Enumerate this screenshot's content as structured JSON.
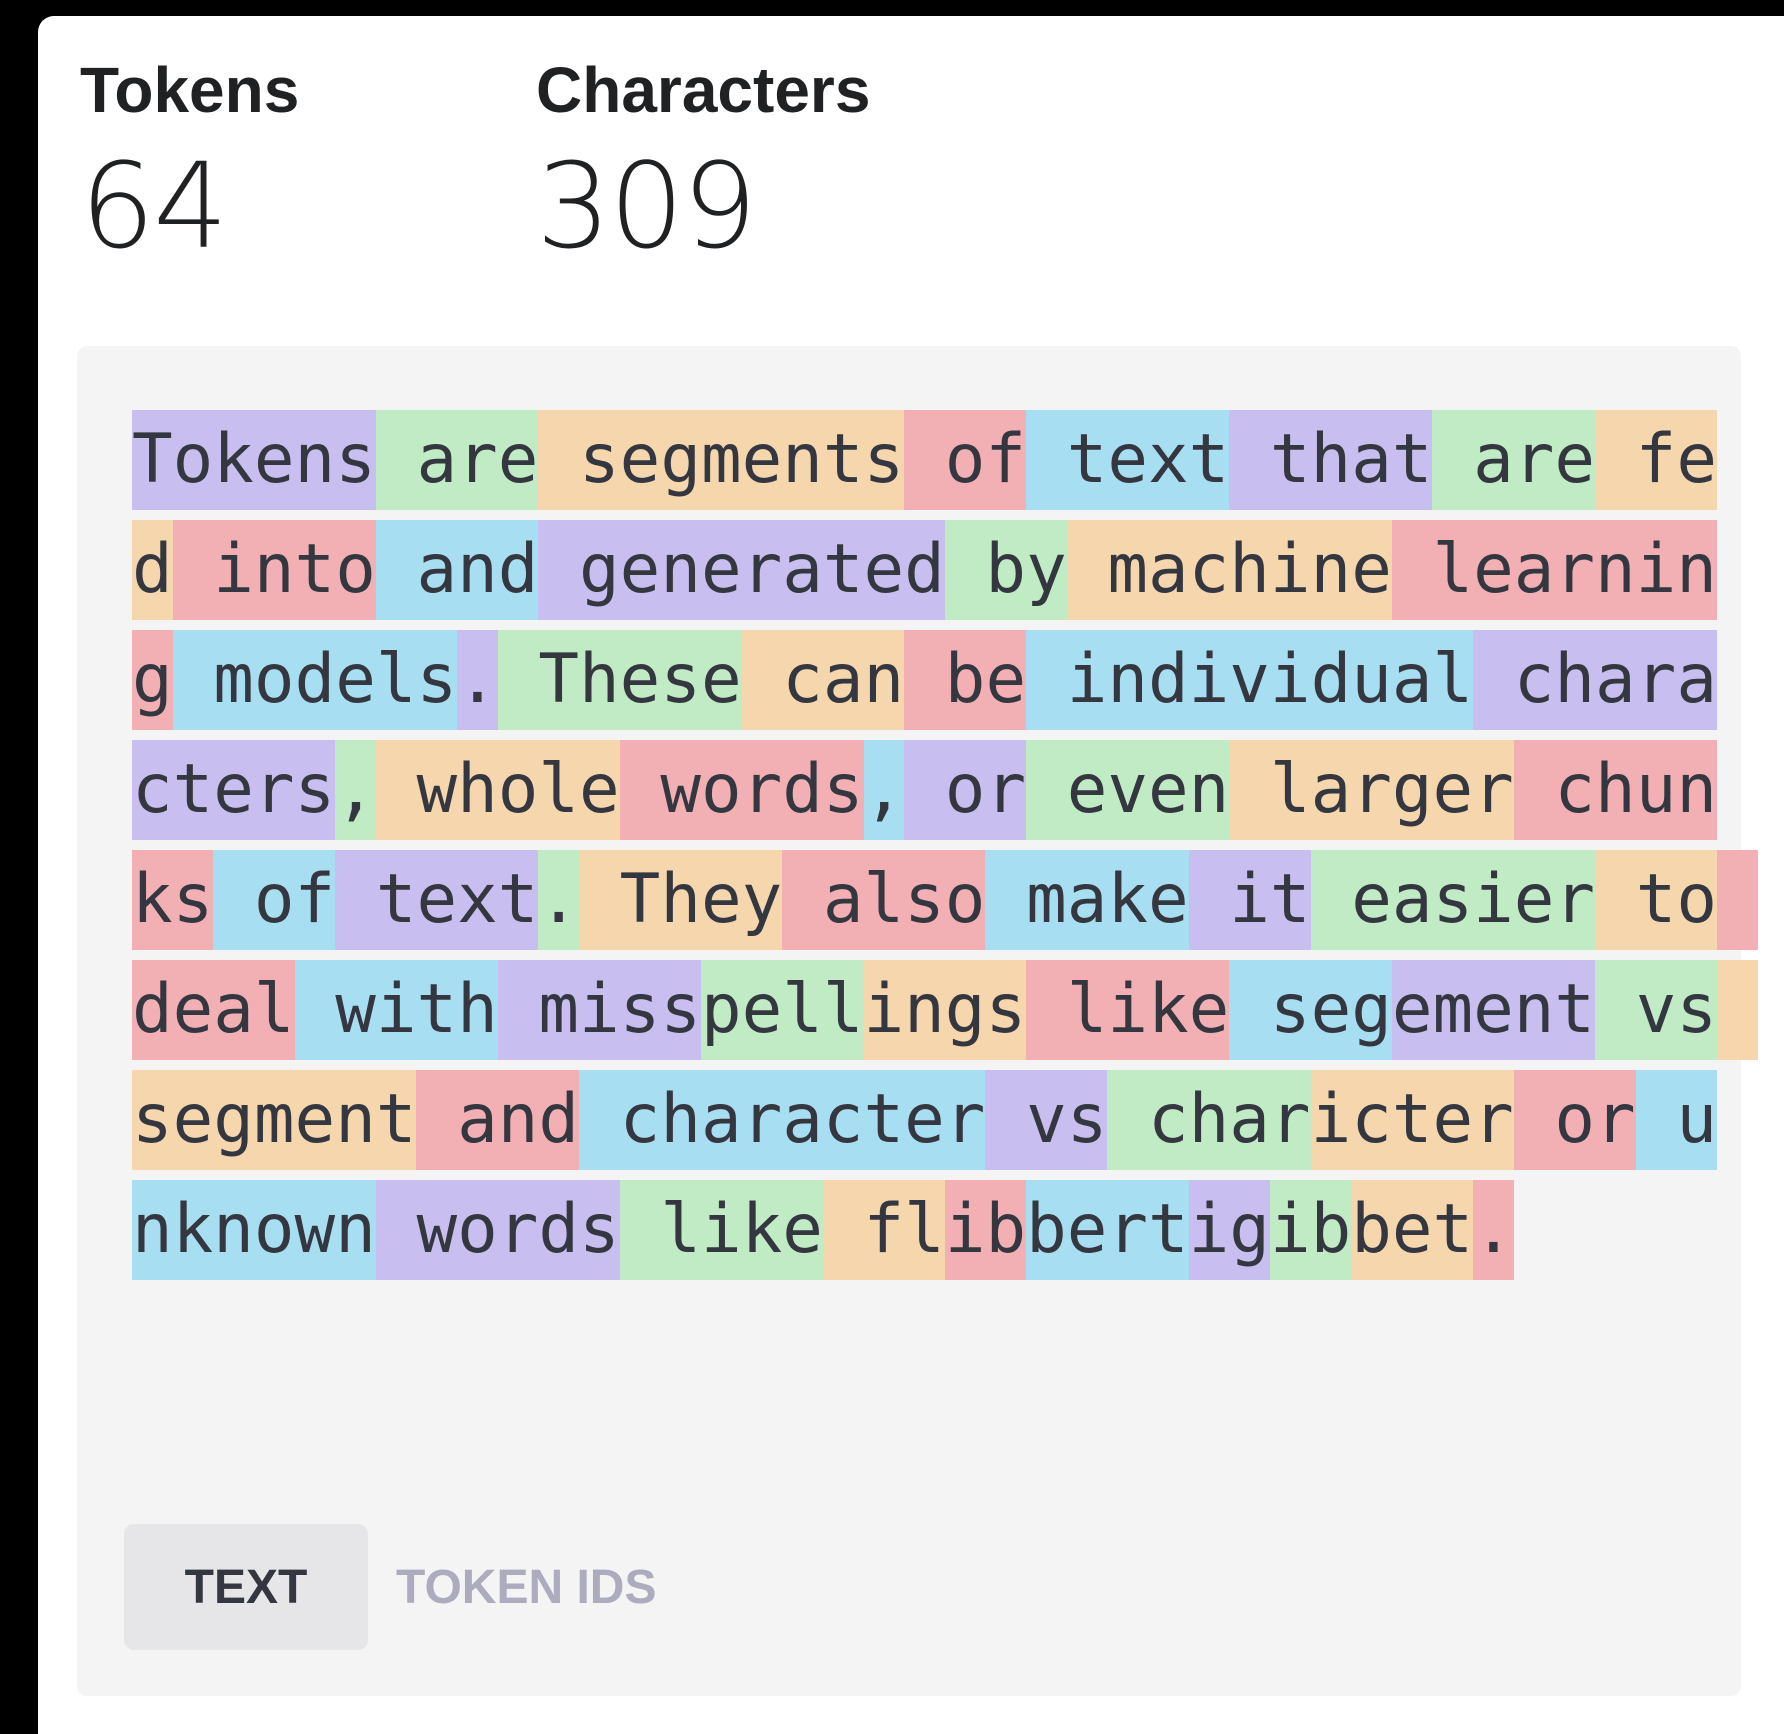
{
  "stats": {
    "tokens_label": "Tokens",
    "tokens_value": "64",
    "characters_label": "Characters",
    "characters_value": "309"
  },
  "token_colors": [
    "#c8bef0",
    "#c0ebc4",
    "#f5d6ad",
    "#f2b0b5",
    "#a8def2"
  ],
  "tokens": [
    {
      "t": "Tokens",
      "c": 0
    },
    {
      "t": " are",
      "c": 1
    },
    {
      "t": " segments",
      "c": 2
    },
    {
      "t": " of",
      "c": 3
    },
    {
      "t": " text",
      "c": 4
    },
    {
      "t": " that",
      "c": 0
    },
    {
      "t": " are",
      "c": 1
    },
    {
      "t": " fed",
      "c": 2
    },
    {
      "t": " into",
      "c": 3
    },
    {
      "t": " and",
      "c": 4
    },
    {
      "t": " generated",
      "c": 0
    },
    {
      "t": " by",
      "c": 1
    },
    {
      "t": " machine",
      "c": 2
    },
    {
      "t": " learning",
      "c": 3
    },
    {
      "t": " models",
      "c": 4
    },
    {
      "t": ".",
      "c": 0
    },
    {
      "t": " These",
      "c": 1
    },
    {
      "t": " can",
      "c": 2
    },
    {
      "t": " be",
      "c": 3
    },
    {
      "t": " individual",
      "c": 4
    },
    {
      "t": " characters",
      "c": 0
    },
    {
      "t": ",",
      "c": 1
    },
    {
      "t": " whole",
      "c": 2
    },
    {
      "t": " words",
      "c": 3
    },
    {
      "t": ",",
      "c": 4
    },
    {
      "t": " or",
      "c": 0
    },
    {
      "t": " even",
      "c": 1
    },
    {
      "t": " larger",
      "c": 2
    },
    {
      "t": " chunks",
      "c": 3
    },
    {
      "t": " of",
      "c": 4
    },
    {
      "t": " text",
      "c": 0
    },
    {
      "t": ".",
      "c": 1
    },
    {
      "t": " They",
      "c": 2
    },
    {
      "t": " also",
      "c": 3
    },
    {
      "t": " make",
      "c": 4
    },
    {
      "t": " it",
      "c": 0
    },
    {
      "t": " easier",
      "c": 1
    },
    {
      "t": " to",
      "c": 2
    },
    {
      "t": " deal",
      "c": 3
    },
    {
      "t": " with",
      "c": 4
    },
    {
      "t": " miss",
      "c": 0
    },
    {
      "t": "pell",
      "c": 1
    },
    {
      "t": "ings",
      "c": 2
    },
    {
      "t": " like",
      "c": 3
    },
    {
      "t": " seg",
      "c": 4
    },
    {
      "t": "ement",
      "c": 0
    },
    {
      "t": " vs",
      "c": 1
    },
    {
      "t": " segment",
      "c": 2
    },
    {
      "t": " and",
      "c": 3
    },
    {
      "t": " character",
      "c": 4
    },
    {
      "t": " vs",
      "c": 0
    },
    {
      "t": " char",
      "c": 1
    },
    {
      "t": "icter",
      "c": 2
    },
    {
      "t": " or",
      "c": 3
    },
    {
      "t": " unknown",
      "c": 4
    },
    {
      "t": " words",
      "c": 0
    },
    {
      "t": " like",
      "c": 1
    },
    {
      "t": " fl",
      "c": 2
    },
    {
      "t": "ib",
      "c": 3
    },
    {
      "t": "bert",
      "c": 4
    },
    {
      "t": "ig",
      "c": 0
    },
    {
      "t": "ib",
      "c": 1
    },
    {
      "t": "bet",
      "c": 2
    },
    {
      "t": ".",
      "c": 3
    }
  ],
  "tabs": {
    "text_label": "TEXT",
    "token_ids_label": "TOKEN IDS"
  }
}
